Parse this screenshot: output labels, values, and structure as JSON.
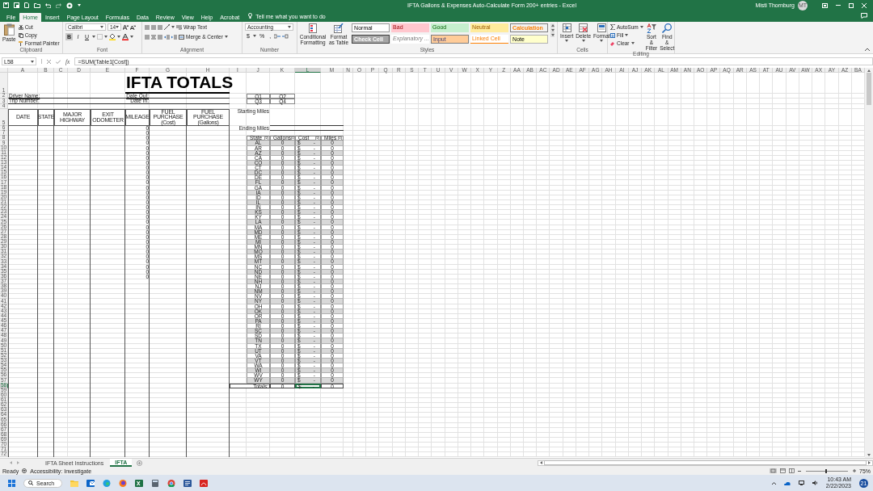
{
  "window": {
    "title": "IFTA Gallons & Expenses Auto-Calculate Form 200+ entries  -  Excel",
    "user_name": "Misti Thornburg",
    "user_initials": "MT"
  },
  "ribbon_tabs": [
    {
      "label": "File",
      "selected": false
    },
    {
      "label": "Home",
      "selected": true
    },
    {
      "label": "Insert",
      "selected": false
    },
    {
      "label": "Page Layout",
      "selected": false
    },
    {
      "label": "Formulas",
      "selected": false
    },
    {
      "label": "Data",
      "selected": false
    },
    {
      "label": "Review",
      "selected": false
    },
    {
      "label": "View",
      "selected": false
    },
    {
      "label": "Help",
      "selected": false
    },
    {
      "label": "Acrobat",
      "selected": false
    }
  ],
  "tell_me": "Tell me what you want to do",
  "ribbon": {
    "clipboard": {
      "paste": "Paste",
      "cut": "Cut",
      "copy": "Copy",
      "format_painter": "Format Painter",
      "label": "Clipboard"
    },
    "font": {
      "name": "Calibri",
      "size": "14",
      "bold": "B",
      "italic": "I",
      "underline": "U",
      "label": "Font"
    },
    "alignment": {
      "wrap_text": "Wrap Text",
      "merge_center": "Merge & Center",
      "label": "Alignment"
    },
    "number": {
      "format": "Accounting",
      "currency": "$",
      "percent": "%",
      "comma": ",",
      "label": "Number"
    },
    "styles": {
      "conditional_formatting": "Conditional Formatting",
      "format_as_table": "Format as Table",
      "label": "Styles",
      "gallery": [
        {
          "label": "Normal",
          "kind": "normal"
        },
        {
          "label": "Bad",
          "kind": "bad"
        },
        {
          "label": "Good",
          "kind": "good"
        },
        {
          "label": "Neutral",
          "kind": "neutral"
        },
        {
          "label": "Calculation",
          "kind": "calculation"
        },
        {
          "label": "Check Cell",
          "kind": "check"
        },
        {
          "label": "Explanatory ...",
          "kind": "explanatory"
        },
        {
          "label": "Input",
          "kind": "input"
        },
        {
          "label": "Linked Cell",
          "kind": "linked"
        },
        {
          "label": "Note",
          "kind": "note"
        }
      ]
    },
    "cells": {
      "insert": "Insert",
      "delete": "Delete",
      "format": "Format",
      "label": "Cells"
    },
    "editing": {
      "autosum": "AutoSum",
      "fill": "Fill",
      "clear": "Clear",
      "sort_filter": "Sort & Filter",
      "find_select": "Find & Select",
      "label": "Editing"
    }
  },
  "formula_bar": {
    "name_box": "L58",
    "function_label": "fx",
    "formula": "=SUM(Table1[Cost])"
  },
  "sheet": {
    "column_headers": [
      {
        "label": "A",
        "selected": false
      },
      {
        "label": "B",
        "selected": false
      },
      {
        "label": "C",
        "selected": false
      },
      {
        "label": "D",
        "selected": false
      },
      {
        "label": "E",
        "selected": false
      },
      {
        "label": "F",
        "selected": false
      },
      {
        "label": "G",
        "selected": false
      },
      {
        "label": "H",
        "selected": false
      },
      {
        "label": "I",
        "selected": false
      },
      {
        "label": "J",
        "selected": false
      },
      {
        "label": "K",
        "selected": false
      },
      {
        "label": "L",
        "selected": true
      },
      {
        "label": "M",
        "selected": false
      },
      {
        "label": "N",
        "selected": false
      },
      {
        "label": "O",
        "selected": false
      },
      {
        "label": "P",
        "selected": false
      },
      {
        "label": "Q",
        "selected": false
      },
      {
        "label": "R",
        "selected": false
      },
      {
        "label": "S",
        "selected": false
      },
      {
        "label": "T",
        "selected": false
      },
      {
        "label": "U",
        "selected": false
      },
      {
        "label": "V",
        "selected": false
      },
      {
        "label": "W",
        "selected": false
      },
      {
        "label": "X",
        "selected": false
      },
      {
        "label": "Y",
        "selected": false
      },
      {
        "label": "Z",
        "selected": false
      },
      {
        "label": "AA",
        "selected": false
      },
      {
        "label": "AB",
        "selected": false
      },
      {
        "label": "AC",
        "selected": false
      },
      {
        "label": "AD",
        "selected": false
      },
      {
        "label": "AE",
        "selected": false
      },
      {
        "label": "AF",
        "selected": false
      },
      {
        "label": "AG",
        "selected": false
      },
      {
        "label": "AH",
        "selected": false
      },
      {
        "label": "AI",
        "selected": false
      },
      {
        "label": "AJ",
        "selected": false
      },
      {
        "label": "AK",
        "selected": false
      },
      {
        "label": "AL",
        "selected": false
      },
      {
        "label": "AM",
        "selected": false
      },
      {
        "label": "AN",
        "selected": false
      },
      {
        "label": "AO",
        "selected": false
      },
      {
        "label": "AP",
        "selected": false
      },
      {
        "label": "AQ",
        "selected": false
      },
      {
        "label": "AR",
        "selected": false
      },
      {
        "label": "AS",
        "selected": false
      },
      {
        "label": "AT",
        "selected": false
      },
      {
        "label": "AU",
        "selected": false
      },
      {
        "label": "AV",
        "selected": false
      },
      {
        "label": "AW",
        "selected": false
      },
      {
        "label": "AX",
        "selected": false
      },
      {
        "label": "AY",
        "selected": false
      },
      {
        "label": "AZ",
        "selected": false
      },
      {
        "label": "BA",
        "selected": false
      }
    ],
    "row_headers": [
      {
        "label": "1",
        "selected": false
      },
      {
        "label": "2",
        "selected": false
      },
      {
        "label": "3",
        "selected": false
      },
      {
        "label": "4",
        "selected": false
      },
      {
        "label": "5",
        "selected": false
      },
      {
        "label": "6",
        "selected": false
      },
      {
        "label": "7",
        "selected": false
      },
      {
        "label": "8",
        "selected": false
      },
      {
        "label": "9",
        "selected": false
      },
      {
        "label": "10",
        "selected": false
      },
      {
        "label": "11",
        "selected": false
      },
      {
        "label": "12",
        "selected": false
      },
      {
        "label": "13",
        "selected": false
      },
      {
        "label": "14",
        "selected": false
      },
      {
        "label": "15",
        "selected": false
      },
      {
        "label": "16",
        "selected": false
      },
      {
        "label": "17",
        "selected": false
      },
      {
        "label": "18",
        "selected": false
      },
      {
        "label": "19",
        "selected": false
      },
      {
        "label": "20",
        "selected": false
      },
      {
        "label": "21",
        "selected": false
      },
      {
        "label": "22",
        "selected": false
      },
      {
        "label": "23",
        "selected": false
      },
      {
        "label": "24",
        "selected": false
      },
      {
        "label": "25",
        "selected": false
      },
      {
        "label": "26",
        "selected": false
      },
      {
        "label": "27",
        "selected": false
      },
      {
        "label": "28",
        "selected": false
      },
      {
        "label": "29",
        "selected": false
      },
      {
        "label": "30",
        "selected": false
      },
      {
        "label": "31",
        "selected": false
      },
      {
        "label": "32",
        "selected": false
      },
      {
        "label": "33",
        "selected": false
      },
      {
        "label": "34",
        "selected": false
      },
      {
        "label": "35",
        "selected": false
      },
      {
        "label": "36",
        "selected": false
      },
      {
        "label": "37",
        "selected": false
      },
      {
        "label": "38",
        "selected": false
      },
      {
        "label": "39",
        "selected": false
      },
      {
        "label": "40",
        "selected": false
      },
      {
        "label": "41",
        "selected": false
      },
      {
        "label": "42",
        "selected": false
      },
      {
        "label": "43",
        "selected": false
      },
      {
        "label": "44",
        "selected": false
      },
      {
        "label": "45",
        "selected": false
      },
      {
        "label": "46",
        "selected": false
      },
      {
        "label": "47",
        "selected": false
      },
      {
        "label": "48",
        "selected": false
      },
      {
        "label": "49",
        "selected": false
      },
      {
        "label": "50",
        "selected": false
      },
      {
        "label": "51",
        "selected": false
      },
      {
        "label": "52",
        "selected": false
      },
      {
        "label": "53",
        "selected": false
      },
      {
        "label": "54",
        "selected": false
      },
      {
        "label": "55",
        "selected": false
      },
      {
        "label": "56",
        "selected": false
      },
      {
        "label": "57",
        "selected": false
      },
      {
        "label": "58",
        "selected": true
      },
      {
        "label": "59",
        "selected": false
      },
      {
        "label": "60",
        "selected": false
      },
      {
        "label": "61",
        "selected": false
      },
      {
        "label": "62",
        "selected": false
      },
      {
        "label": "63",
        "selected": false
      },
      {
        "label": "64",
        "selected": false
      },
      {
        "label": "65",
        "selected": false
      },
      {
        "label": "66",
        "selected": false
      },
      {
        "label": "67",
        "selected": false
      },
      {
        "label": "68",
        "selected": false
      },
      {
        "label": "69",
        "selected": false
      },
      {
        "label": "70",
        "selected": false
      },
      {
        "label": "71",
        "selected": false
      },
      {
        "label": "72",
        "selected": false
      }
    ],
    "title": "IFTA TOTALS",
    "driver_name_label": "Driver Name:",
    "trip_number_label": "Trip Number:",
    "date_out_label": "Date Out:",
    "date_in_label": "Date In:",
    "quarters": [
      "Q1",
      "Q2",
      "Q3",
      "Q4"
    ],
    "log_columns": [
      "DATE",
      "STATE",
      "MAJOR HIGHWAY",
      "EXIT ODOMETER",
      "MILEAGE",
      "FUEL PURCHASE (Cost)",
      "FUEL PURCHASE (Gallons)"
    ],
    "mileage_values": [
      "0",
      "0",
      "0",
      "0",
      "0",
      "0",
      "0",
      "0",
      "0",
      "0",
      "0",
      "0",
      "0",
      "0",
      "0",
      "0",
      "0",
      "0",
      "0",
      "0",
      "0",
      "0",
      "0",
      "0",
      "0",
      "0",
      "0",
      "0",
      "0",
      "0",
      "0"
    ],
    "starting_miles_label": "Starting Miles",
    "ending_miles_label": "Ending Miles",
    "state_table": {
      "columns": [
        "State",
        "Gallons",
        "Cost",
        "Miles"
      ],
      "rows": [
        {
          "state": "AL",
          "gallons": "0",
          "cost_symbol": "$",
          "cost": "-",
          "miles": "0"
        },
        {
          "state": "AR",
          "gallons": "0",
          "cost_symbol": "$",
          "cost": "-",
          "miles": "0"
        },
        {
          "state": "AZ",
          "gallons": "0",
          "cost_symbol": "$",
          "cost": "-",
          "miles": "0"
        },
        {
          "state": "CA",
          "gallons": "0",
          "cost_symbol": "$",
          "cost": "-",
          "miles": "0"
        },
        {
          "state": "CO",
          "gallons": "0",
          "cost_symbol": "$",
          "cost": "-",
          "miles": "0"
        },
        {
          "state": "CT",
          "gallons": "0",
          "cost_symbol": "$",
          "cost": "-",
          "miles": "0"
        },
        {
          "state": "DC",
          "gallons": "0",
          "cost_symbol": "$",
          "cost": "-",
          "miles": "0"
        },
        {
          "state": "DE",
          "gallons": "0",
          "cost_symbol": "$",
          "cost": "-",
          "miles": "0"
        },
        {
          "state": "FL",
          "gallons": "0",
          "cost_symbol": "$",
          "cost": "-",
          "miles": "0"
        },
        {
          "state": "GA",
          "gallons": "0",
          "cost_symbol": "$",
          "cost": "-",
          "miles": "0"
        },
        {
          "state": "IA",
          "gallons": "0",
          "cost_symbol": "$",
          "cost": "-",
          "miles": "0"
        },
        {
          "state": "ID",
          "gallons": "0",
          "cost_symbol": "$",
          "cost": "-",
          "miles": "0"
        },
        {
          "state": "IL",
          "gallons": "0",
          "cost_symbol": "$",
          "cost": "-",
          "miles": "0"
        },
        {
          "state": "IN",
          "gallons": "0",
          "cost_symbol": "$",
          "cost": "-",
          "miles": "0"
        },
        {
          "state": "KS",
          "gallons": "0",
          "cost_symbol": "$",
          "cost": "-",
          "miles": "0"
        },
        {
          "state": "KY",
          "gallons": "0",
          "cost_symbol": "$",
          "cost": "-",
          "miles": "0"
        },
        {
          "state": "LA",
          "gallons": "0",
          "cost_symbol": "$",
          "cost": "-",
          "miles": "0"
        },
        {
          "state": "MA",
          "gallons": "0",
          "cost_symbol": "$",
          "cost": "-",
          "miles": "0"
        },
        {
          "state": "MD",
          "gallons": "0",
          "cost_symbol": "$",
          "cost": "-",
          "miles": "0"
        },
        {
          "state": "ME",
          "gallons": "0",
          "cost_symbol": "$",
          "cost": "-",
          "miles": "0"
        },
        {
          "state": "MI",
          "gallons": "0",
          "cost_symbol": "$",
          "cost": "-",
          "miles": "0"
        },
        {
          "state": "MN",
          "gallons": "0",
          "cost_symbol": "$",
          "cost": "-",
          "miles": "0"
        },
        {
          "state": "MO",
          "gallons": "0",
          "cost_symbol": "$",
          "cost": "-",
          "miles": "0"
        },
        {
          "state": "MS",
          "gallons": "0",
          "cost_symbol": "$",
          "cost": "-",
          "miles": "0"
        },
        {
          "state": "MT",
          "gallons": "0",
          "cost_symbol": "$",
          "cost": "-",
          "miles": "0"
        },
        {
          "state": "NC",
          "gallons": "0",
          "cost_symbol": "$",
          "cost": "-",
          "miles": "0"
        },
        {
          "state": "ND",
          "gallons": "0",
          "cost_symbol": "$",
          "cost": "-",
          "miles": "0"
        },
        {
          "state": "NE",
          "gallons": "0",
          "cost_symbol": "$",
          "cost": "-",
          "miles": "0"
        },
        {
          "state": "NH",
          "gallons": "0",
          "cost_symbol": "$",
          "cost": "-",
          "miles": "0"
        },
        {
          "state": "NJ",
          "gallons": "0",
          "cost_symbol": "$",
          "cost": "-",
          "miles": "0"
        },
        {
          "state": "NM",
          "gallons": "0",
          "cost_symbol": "$",
          "cost": "-",
          "miles": "0"
        },
        {
          "state": "NV",
          "gallons": "0",
          "cost_symbol": "$",
          "cost": "-",
          "miles": "0"
        },
        {
          "state": "NY",
          "gallons": "0",
          "cost_symbol": "$",
          "cost": "-",
          "miles": "0"
        },
        {
          "state": "OH",
          "gallons": "0",
          "cost_symbol": "$",
          "cost": "-",
          "miles": "0"
        },
        {
          "state": "OK",
          "gallons": "0",
          "cost_symbol": "$",
          "cost": "-",
          "miles": "0"
        },
        {
          "state": "OR",
          "gallons": "0",
          "cost_symbol": "$",
          "cost": "-",
          "miles": "0"
        },
        {
          "state": "PA",
          "gallons": "0",
          "cost_symbol": "$",
          "cost": "-",
          "miles": "0"
        },
        {
          "state": "RI",
          "gallons": "0",
          "cost_symbol": "$",
          "cost": "-",
          "miles": "0"
        },
        {
          "state": "SC",
          "gallons": "0",
          "cost_symbol": "$",
          "cost": "-",
          "miles": "0"
        },
        {
          "state": "SD",
          "gallons": "0",
          "cost_symbol": "$",
          "cost": "-",
          "miles": "0"
        },
        {
          "state": "TN",
          "gallons": "0",
          "cost_symbol": "$",
          "cost": "-",
          "miles": "0"
        },
        {
          "state": "TX",
          "gallons": "0",
          "cost_symbol": "$",
          "cost": "-",
          "miles": "0"
        },
        {
          "state": "UT",
          "gallons": "0",
          "cost_symbol": "$",
          "cost": "-",
          "miles": "0"
        },
        {
          "state": "VA",
          "gallons": "0",
          "cost_symbol": "$",
          "cost": "-",
          "miles": "0"
        },
        {
          "state": "VT",
          "gallons": "0",
          "cost_symbol": "$",
          "cost": "-",
          "miles": "0"
        },
        {
          "state": "WA",
          "gallons": "0",
          "cost_symbol": "$",
          "cost": "-",
          "miles": "0"
        },
        {
          "state": "WI",
          "gallons": "0",
          "cost_symbol": "$",
          "cost": "-",
          "miles": "0"
        },
        {
          "state": "WV",
          "gallons": "0",
          "cost_symbol": "$",
          "cost": "-",
          "miles": "0"
        },
        {
          "state": "WY",
          "gallons": "0",
          "cost_symbol": "$",
          "cost": "-",
          "miles": "0"
        }
      ],
      "totals": {
        "label": "Totals:",
        "gallons": "0",
        "cost_symbol": "$",
        "cost": "-",
        "miles": "0",
        "cost_selected": true
      }
    }
  },
  "sheet_tabs": [
    {
      "label": "IFTA Sheet Instructions",
      "selected": false
    },
    {
      "label": "IFTA",
      "selected": true
    }
  ],
  "status_bar": {
    "ready": "Ready",
    "accessibility": "Accessibility: Investigate",
    "zoom": "75%",
    "zoom_slider": {
      "level": 0.48
    }
  },
  "taskbar": {
    "search": "Search",
    "time": "10:43 AM",
    "date": "2/22/2023",
    "notifications": "21"
  }
}
